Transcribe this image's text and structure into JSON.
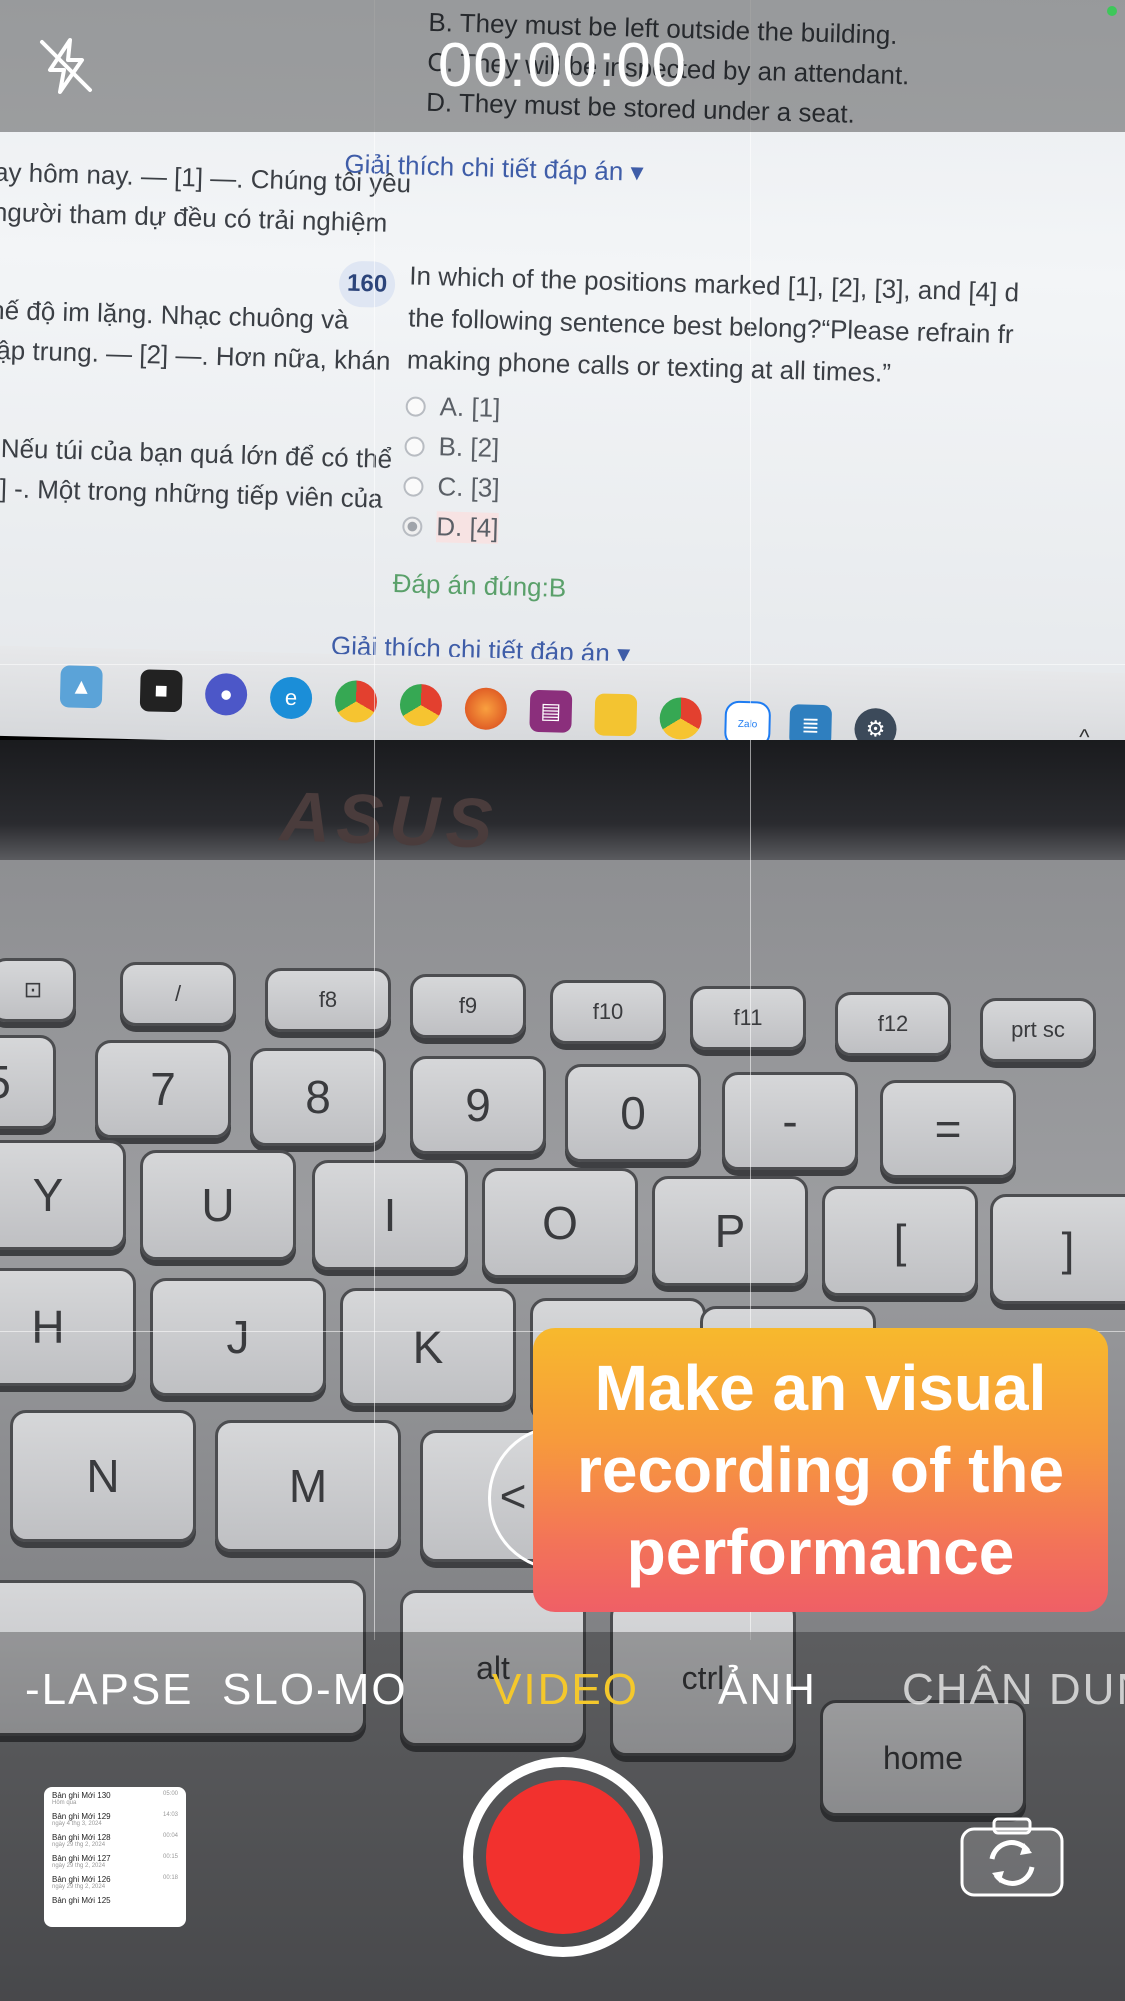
{
  "top_bar": {
    "timer": "00:00:00"
  },
  "screen": {
    "top_lines": [
      "B. They must be left outside the building.",
      "C. They will be inspected by an attendant.",
      "D. They must be stored under a seat."
    ],
    "explain_link": "Giải thích chi tiết đáp án",
    "left_lines": [
      "ay hôm nay. — [1] —. Chúng tôi yêu",
      "người tham dự đều có trải nghiệm",
      "hế độ im lặng. Nhạc chuông và",
      "tập trung. — [2] —. Hơn nữa, khán",
      ". Nếu túi của bạn quá lớn để có thể",
      "4] -. Một trong những tiếp viên của"
    ],
    "question_number": "160",
    "question_lines": [
      "In which of the positions marked [1], [2], [3], and [4] d",
      "the following sentence best belong?“Please refrain fr",
      "making phone calls or texting at all times.”"
    ],
    "options": [
      "A. [1]",
      "B. [2]",
      "C. [3]",
      "D. [4]"
    ],
    "correct_answer": "Đáp án đúng:B",
    "explain_link_2": "Giải thích chi tiết đáp án"
  },
  "laptop": {
    "brand": "ASUS",
    "fn_keys": [
      "f8",
      "f9",
      "f10",
      "f11",
      "f12",
      "prt sc"
    ],
    "num_keys": [
      "7",
      "8",
      "9",
      "0",
      "-",
      "="
    ],
    "row2_keys": [
      "Y",
      "U",
      "I",
      "O",
      "P",
      "[",
      "]"
    ],
    "row3_keys": [
      "H",
      "J",
      "K"
    ],
    "row4_keys": [
      "N",
      "M"
    ],
    "bottom_keys": [
      "alt",
      "ctrl",
      "home"
    ],
    "taskbar_zalo": "Zalo"
  },
  "modes": {
    "items": [
      {
        "label": "-LAPSE"
      },
      {
        "label": "SLO-MO"
      },
      {
        "label": "VIDEO"
      },
      {
        "label": "ẢNH"
      },
      {
        "label": "CHÂN DUN"
      }
    ],
    "active": "VIDEO"
  },
  "gallery_thumbnail": {
    "items": [
      {
        "title": "Bản ghi Mới 130",
        "sub": "Hôm qua",
        "dur": "05:00"
      },
      {
        "title": "Bản ghi Mới 129",
        "sub": "ngày 4 thg 3, 2024",
        "dur": "14:03"
      },
      {
        "title": "Bản ghi Mới 128",
        "sub": "ngày 29 thg 2, 2024",
        "dur": "00:04"
      },
      {
        "title": "Bản ghi Mới 127",
        "sub": "ngày 29 thg 2, 2024",
        "dur": "00:15"
      },
      {
        "title": "Bản ghi Mới 126",
        "sub": "ngày 29 thg 2, 2024",
        "dur": "00:18"
      },
      {
        "title": "Bản ghi Mới 125",
        "sub": "",
        "dur": ""
      }
    ]
  },
  "caption": {
    "text": "Make an visual recording of the performance"
  },
  "colors": {
    "active_mode": "#f4c82c",
    "record_button": "#f2312e",
    "caption_gradient_top": "#f7b92d",
    "caption_gradient_bottom": "#ef5f66"
  },
  "icons": {
    "flash": "flash-off-icon",
    "flip": "camera-flip-icon",
    "record": "record-icon"
  }
}
